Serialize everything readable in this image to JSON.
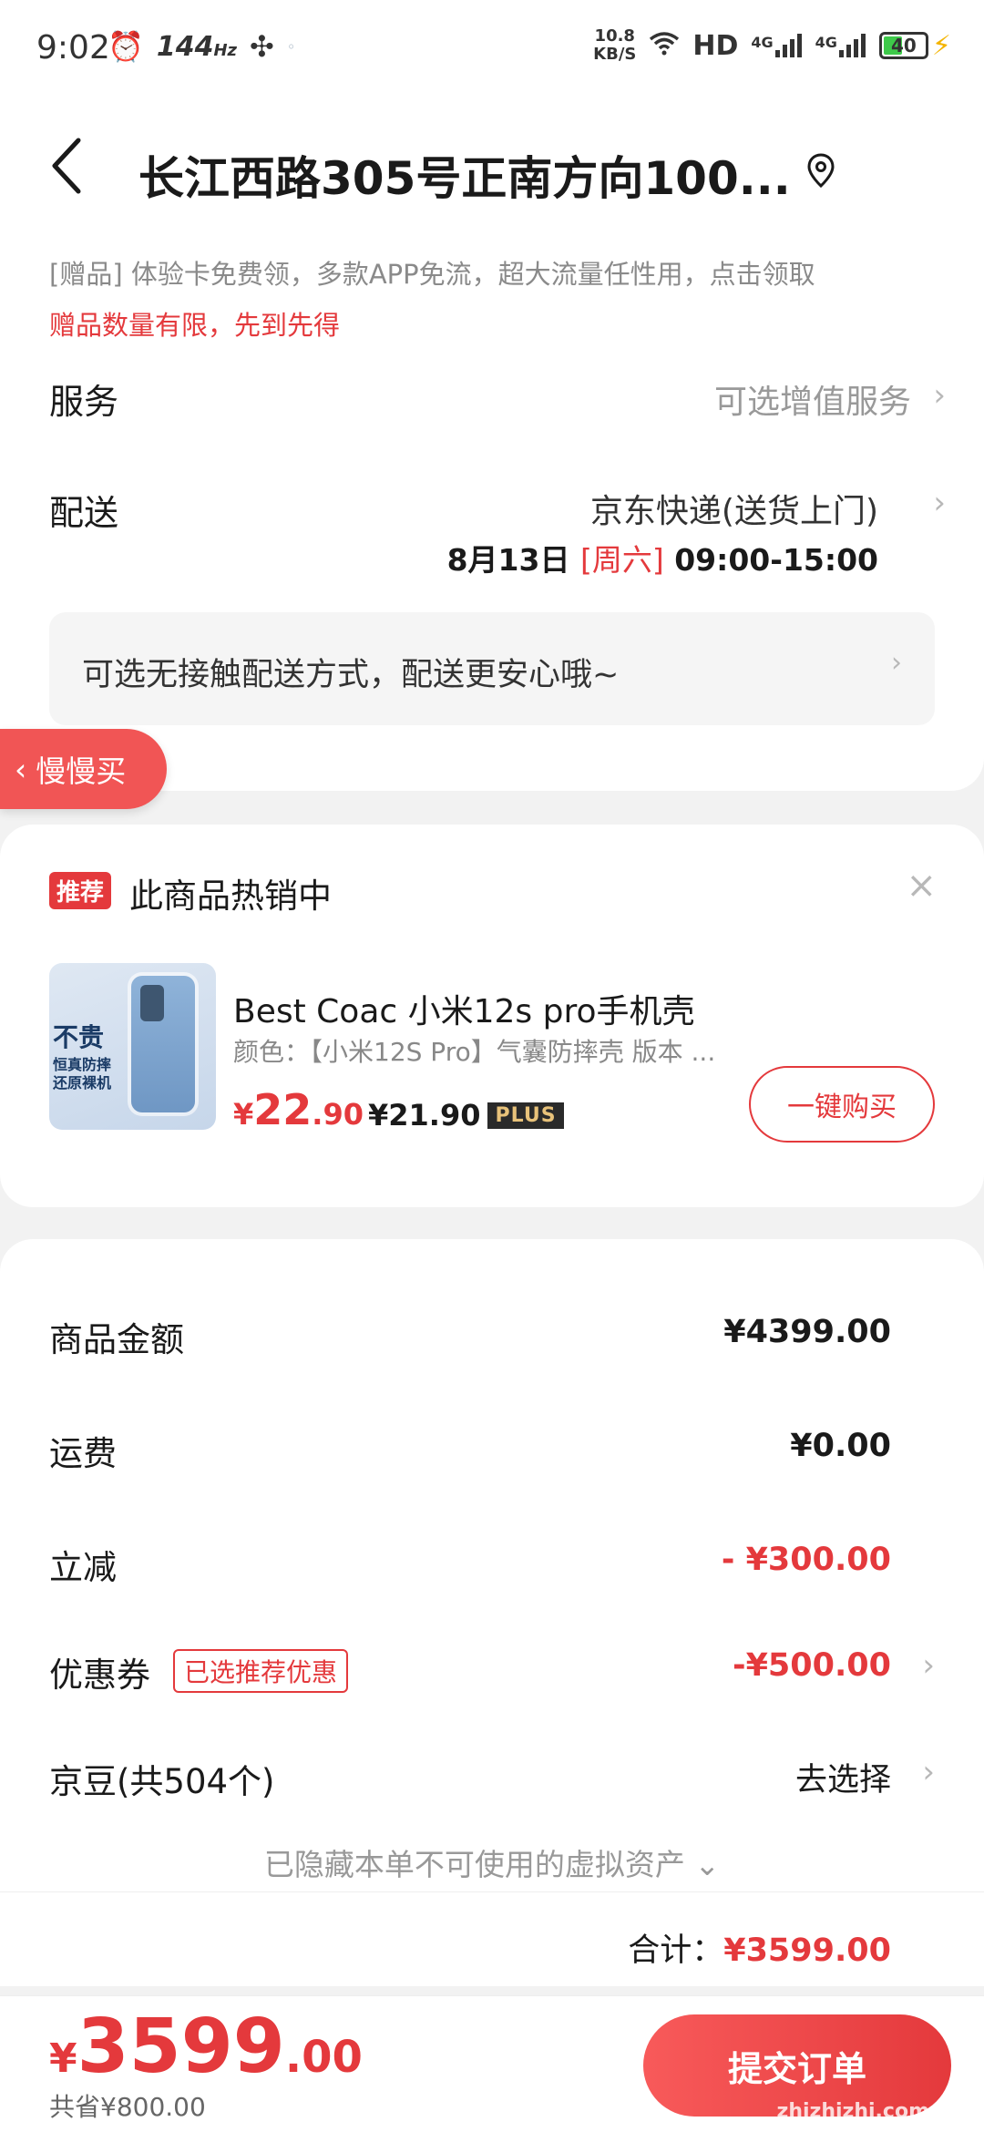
{
  "status_bar": {
    "time": "9:02",
    "refresh_rate": "144",
    "refresh_unit": "Hz",
    "net_speed_value": "10.8",
    "net_speed_unit": "KB/S",
    "hd": "HD",
    "sig1": "4G",
    "sig2": "4G",
    "battery": "40"
  },
  "header": {
    "address": "长江西路305号正南方向100..."
  },
  "gift": {
    "line": "[赠品]  体验卡免费领，多款APP免流，超大流量任性用，点击领取",
    "note": "赠品数量有限，先到先得"
  },
  "service": {
    "label": "服务",
    "value": "可选增值服务"
  },
  "delivery": {
    "label": "配送",
    "value": "京东快递(送货上门)",
    "date": "8月13日",
    "weekday": "[周六]",
    "time": "09:00-15:00"
  },
  "notice": {
    "text": "可选无接触配送方式，配送更安心哦~"
  },
  "slow_buy": {
    "label": "慢慢买"
  },
  "recommend": {
    "tag": "推荐",
    "title": "此商品热销中",
    "close": "×",
    "image_text_a": "不贵",
    "image_text_b": "恒真防摔",
    "image_text_c": "还原裸机",
    "product_name": "Best Coac 小米12s pro手机壳",
    "product_spec": "颜色：【小米12S Pro】气囊防摔壳   版本 ...",
    "price_yen": "¥",
    "price_int": "22",
    "price_dec": ".90",
    "plus_price": "¥21.90",
    "plus_badge": "PLUS",
    "buy_label": "一键购买"
  },
  "price": {
    "goods_label": "商品金额",
    "goods_value": "¥4399.00",
    "shipping_label": "运费",
    "shipping_value": "¥0.00",
    "discount_label": "立减",
    "discount_value": "- ¥300.00",
    "coupon_label": "优惠券",
    "coupon_tag": "已选推荐优惠",
    "coupon_value": "-¥500.00",
    "beans_label": "京豆(共504个)",
    "beans_value": "去选择",
    "hidden_assets": "已隐藏本单不可使用的虚拟资产",
    "total_label": "合计：",
    "total_value": "¥3599.00"
  },
  "bottom": {
    "yen": "¥",
    "price_int": "3599",
    "price_dec": ".00",
    "saved": "共省¥800.00",
    "submit": "提交订单",
    "watermark": "zhizhizhi.com"
  }
}
